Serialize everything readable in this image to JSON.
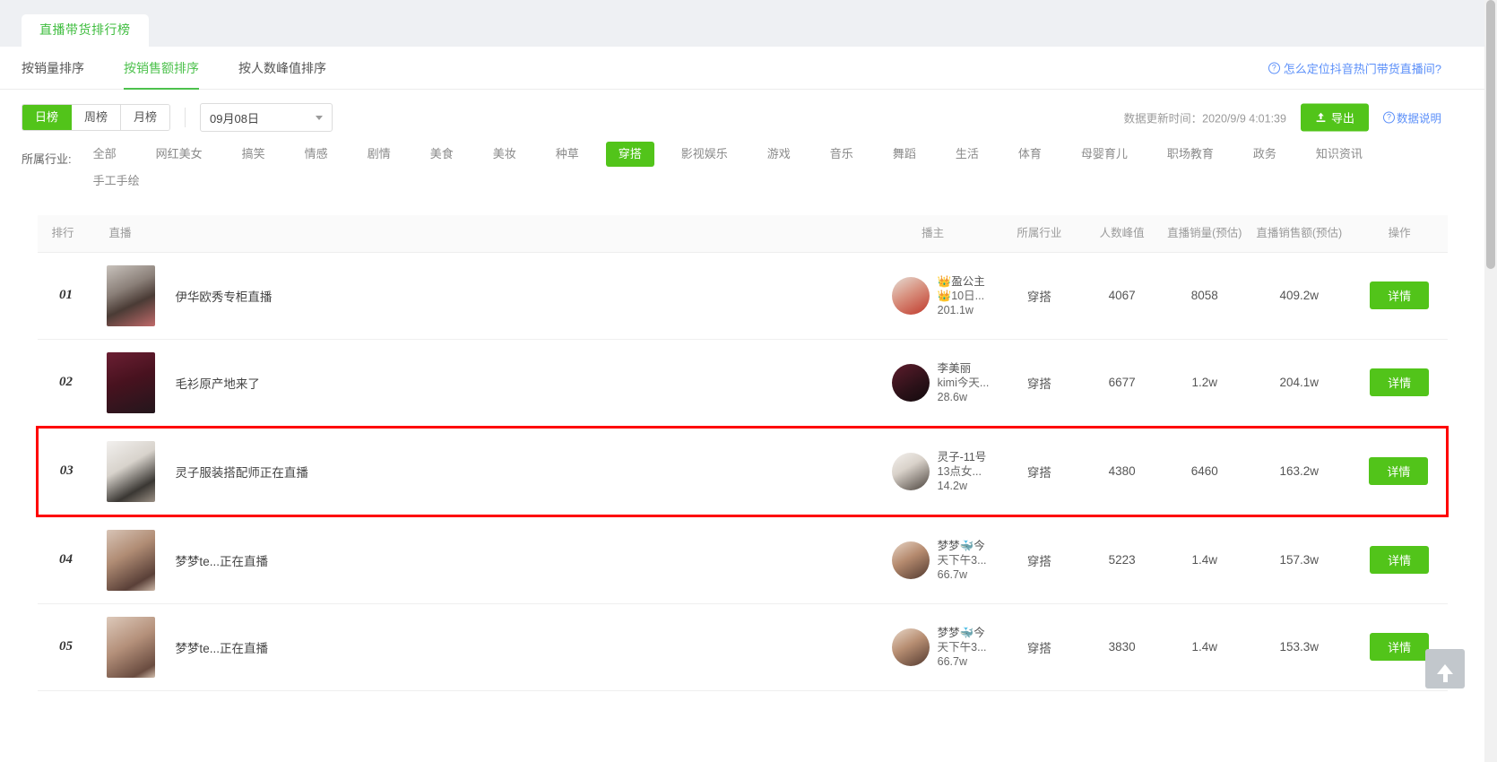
{
  "window": {
    "doc_tab": "直播带货排行榜"
  },
  "sort_tabs": [
    {
      "label": "按销量排序",
      "active": false
    },
    {
      "label": "按销售额排序",
      "active": true
    },
    {
      "label": "按人数峰值排序",
      "active": false
    }
  ],
  "help_link": {
    "icon": "question-circle-icon",
    "label": "怎么定位抖音热门带货直播间?"
  },
  "filters": {
    "period": [
      {
        "label": "日榜",
        "active": true
      },
      {
        "label": "周榜",
        "active": false
      },
      {
        "label": "月榜",
        "active": false
      }
    ],
    "date_select": {
      "value": "09月08日",
      "icon": "chevron-down-icon"
    },
    "update_time": "数据更新时间：2020/9/9 4:01:39",
    "export_button": {
      "label": "导出",
      "icon": "upload-icon"
    },
    "data_desc": {
      "label": "数据说明",
      "icon": "question-circle-icon"
    }
  },
  "industry": {
    "label": "所属行业:",
    "tags": [
      {
        "label": "全部",
        "active": false
      },
      {
        "label": "网红美女",
        "active": false
      },
      {
        "label": "搞笑",
        "active": false
      },
      {
        "label": "情感",
        "active": false
      },
      {
        "label": "剧情",
        "active": false
      },
      {
        "label": "美食",
        "active": false
      },
      {
        "label": "美妆",
        "active": false
      },
      {
        "label": "种草",
        "active": false
      },
      {
        "label": "穿搭",
        "active": true
      },
      {
        "label": "影视娱乐",
        "active": false
      },
      {
        "label": "游戏",
        "active": false
      },
      {
        "label": "音乐",
        "active": false
      },
      {
        "label": "舞蹈",
        "active": false
      },
      {
        "label": "生活",
        "active": false
      },
      {
        "label": "体育",
        "active": false
      },
      {
        "label": "母婴育儿",
        "active": false
      },
      {
        "label": "职场教育",
        "active": false
      },
      {
        "label": "政务",
        "active": false
      },
      {
        "label": "知识资讯",
        "active": false
      },
      {
        "label": "手工手绘",
        "active": false
      }
    ]
  },
  "table": {
    "columns": [
      "排行",
      "直播",
      "播主",
      "所属行业",
      "人数峰值",
      "直播销量(预估)",
      "直播销售额(预估)",
      "操作"
    ],
    "action_label": "详情",
    "rows": [
      {
        "rank": "01",
        "live_title": "伊华欧秀专柜直播",
        "host_name": "👑盈公主",
        "host_sub": "👑10日...",
        "host_fans": "201.1w",
        "industry": "穿搭",
        "peak_viewers": "4067",
        "sales_volume": "8058",
        "sales_amount": "409.2w",
        "highlighted": false
      },
      {
        "rank": "02",
        "live_title": "毛衫原产地来了",
        "host_name": "李美丽",
        "host_sub": "kimi今天...",
        "host_fans": "28.6w",
        "industry": "穿搭",
        "peak_viewers": "6677",
        "sales_volume": "1.2w",
        "sales_amount": "204.1w",
        "highlighted": false
      },
      {
        "rank": "03",
        "live_title": "灵子服装搭配师正在直播",
        "host_name": "灵子-11号",
        "host_sub": "13点女...",
        "host_fans": "14.2w",
        "industry": "穿搭",
        "peak_viewers": "4380",
        "sales_volume": "6460",
        "sales_amount": "163.2w",
        "highlighted": true
      },
      {
        "rank": "04",
        "live_title": "梦梦te...正在直播",
        "host_name": "梦梦🐳今",
        "host_sub": "天下午3...",
        "host_fans": "66.7w",
        "industry": "穿搭",
        "peak_viewers": "5223",
        "sales_volume": "1.4w",
        "sales_amount": "157.3w",
        "highlighted": false
      },
      {
        "rank": "05",
        "live_title": "梦梦te...正在直播",
        "host_name": "梦梦🐳今",
        "host_sub": "天下午3...",
        "host_fans": "66.7w",
        "industry": "穿搭",
        "peak_viewers": "3830",
        "sales_volume": "1.4w",
        "sales_amount": "153.3w",
        "highlighted": false
      }
    ]
  },
  "back_to_top": {
    "icon": "arrow-up-icon"
  },
  "colors": {
    "accent_green": "#52c41a",
    "link_blue": "#5b8ff9",
    "highlight_red": "#fe0000"
  }
}
